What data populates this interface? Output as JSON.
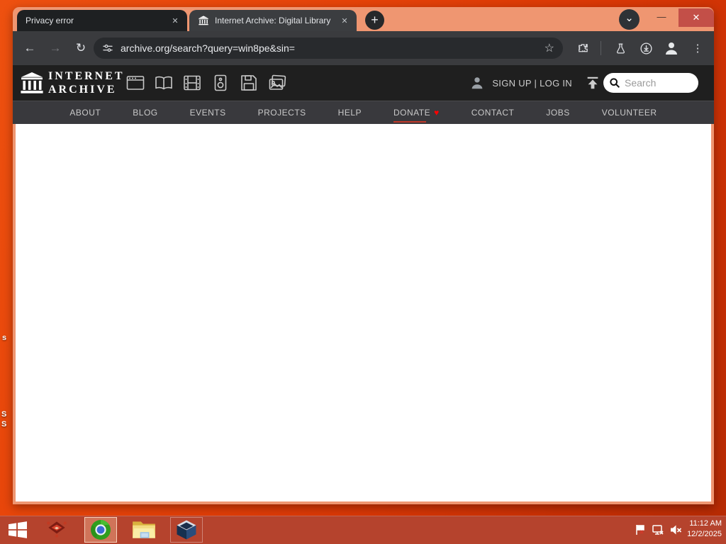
{
  "browser": {
    "tabs": [
      {
        "title": "Privacy error"
      },
      {
        "title": "Internet Archive: Digital Library"
      }
    ],
    "url": "archive.org/search?query=win8pe&sin="
  },
  "ia_header": {
    "wordmark_line1": "INTERNET",
    "wordmark_line2": "ARCHIVE",
    "signup_login": "SIGN UP | LOG IN",
    "search_placeholder": "Search"
  },
  "nav": {
    "items": [
      "ABOUT",
      "BLOG",
      "EVENTS",
      "PROJECTS",
      "HELP",
      "DONATE",
      "CONTACT",
      "JOBS",
      "VOLUNTEER"
    ]
  },
  "taskbar": {
    "clock_time": "11:12 AM",
    "clock_date": "12/2/2025"
  },
  "desktop": {
    "icon_fragments": [
      "s",
      "S",
      "S"
    ]
  },
  "icons": {
    "close": "✕",
    "new_tab": "+",
    "chevron_down": "⌄",
    "minimize": "—",
    "back": "←",
    "forward": "→",
    "reload": "↻",
    "star": "☆",
    "menu_dots": "⋮",
    "heart": "♥"
  },
  "colors": {
    "titlebar_salmon": "#EF9671",
    "desktop_red": "#E2430B",
    "taskbar_red": "#B5432D",
    "toolbar_dark": "#3A3B3E",
    "ia_header_dark": "#1F1F1F",
    "nav_bar_dark": "#39393D",
    "donate_heart_red": "#FF0000",
    "close_button_red": "#C34F48"
  }
}
